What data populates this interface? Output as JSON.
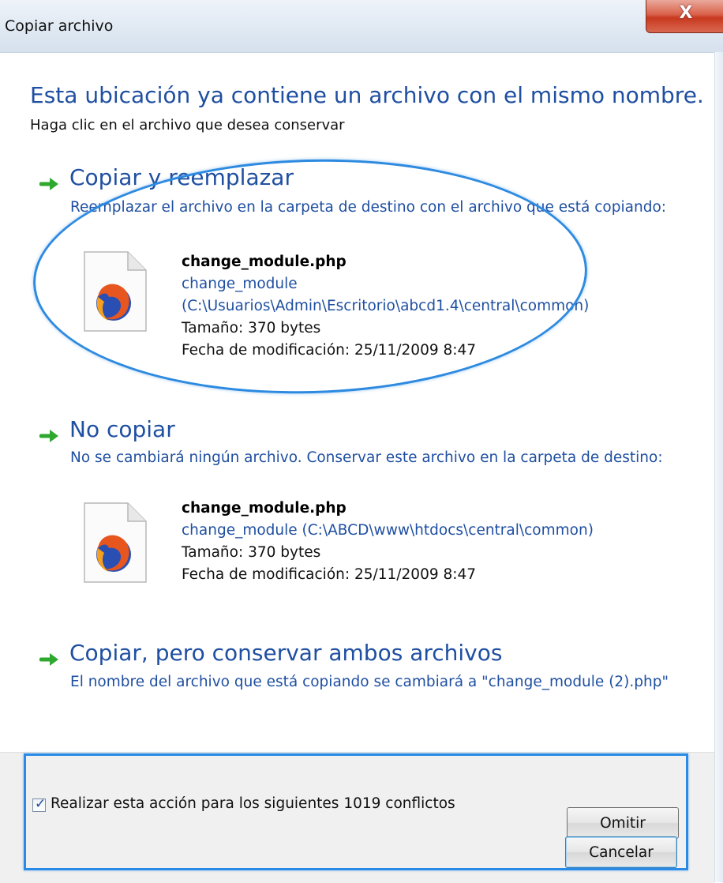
{
  "window": {
    "title": "Copiar archivo",
    "close_glyph": "X"
  },
  "heading": "Esta ubicación ya contiene un archivo con el mismo nombre.",
  "subheading": "Haga clic en el archivo que desea conservar",
  "options": [
    {
      "title": "Copiar y reemplazar",
      "desc": "Reemplazar el archivo en la carpeta de destino con el archivo que está copiando:",
      "file": {
        "name": "change_module.php",
        "path_line1": "change_module",
        "path_line2": "(C:\\Usuarios\\Admin\\Escritorio\\abcd1.4\\central\\common)",
        "size": "Tamaño: 370 bytes",
        "modified": "Fecha de modificación: 25/11/2009 8:47"
      }
    },
    {
      "title": "No copiar",
      "desc": "No se cambiará ningún archivo. Conservar este archivo en la carpeta de destino:",
      "file": {
        "name": "change_module.php",
        "path_line1": "change_module (C:\\ABCD\\www\\htdocs\\central\\common)",
        "size": "Tamaño: 370 bytes",
        "modified": "Fecha de modificación: 25/11/2009 8:47"
      }
    },
    {
      "title": "Copiar, pero conservar ambos archivos",
      "desc": "El nombre del archivo que está copiando se cambiará a \"change_module (2).php\""
    }
  ],
  "footer": {
    "checkbox_label": "Realizar esta acción para los siguientes 1019 conflictos",
    "checkbox_checked": true,
    "skip_button": "Omitir",
    "cancel_button": "Cancelar"
  },
  "colors": {
    "accent_text": "#1f4fa1",
    "arrow_green": "#2fa82f",
    "annotation_blue": "#2d8ae0"
  },
  "icons": [
    "green-arrow-icon",
    "firefox-file-icon",
    "checkmark-icon",
    "close-icon"
  ]
}
